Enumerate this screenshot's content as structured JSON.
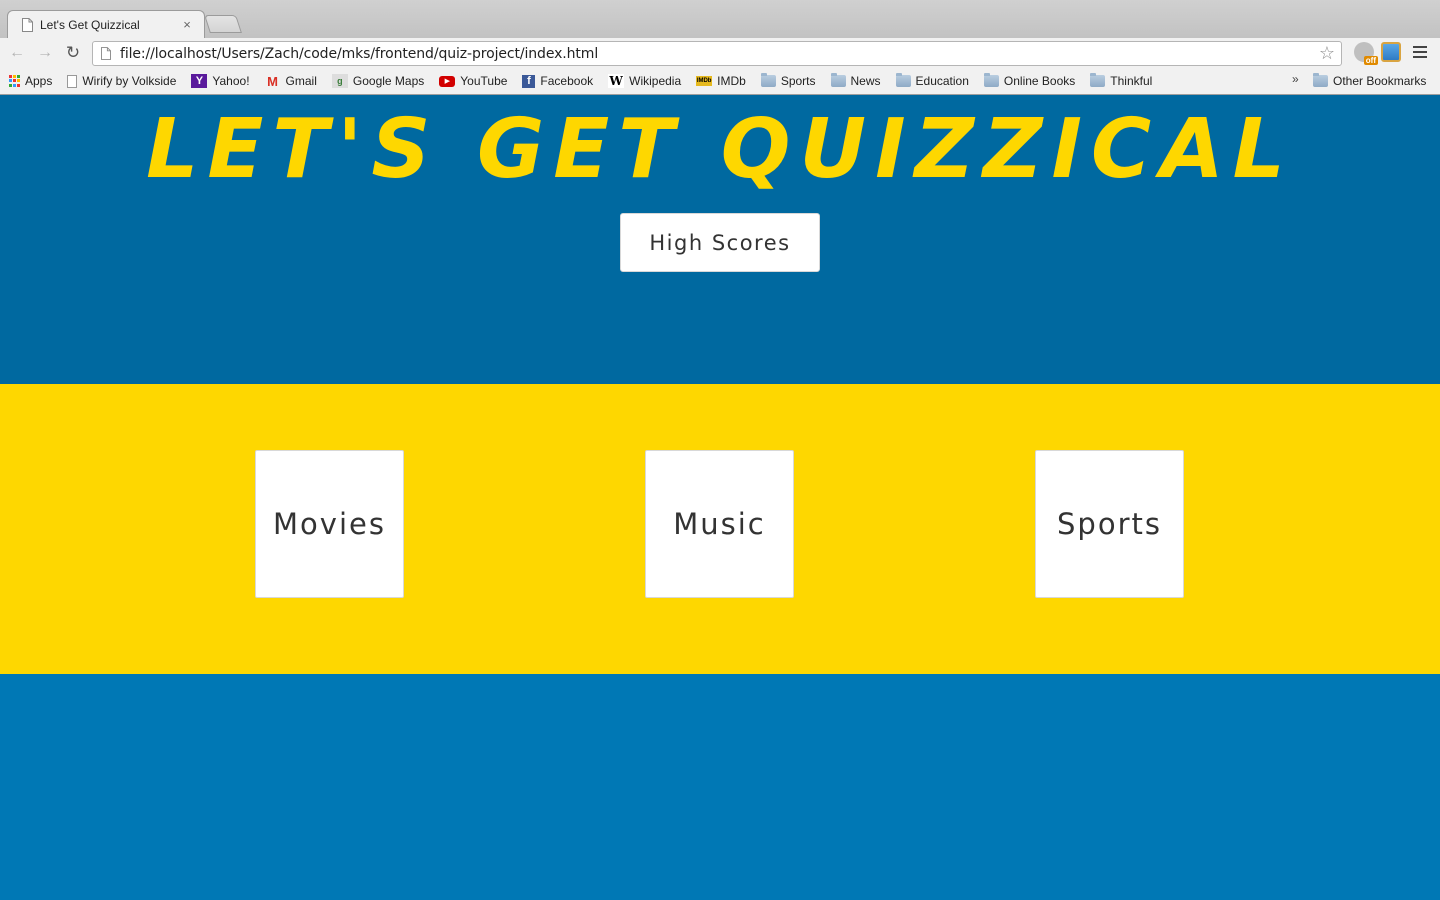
{
  "browser": {
    "tab_title": "Let's Get Quizzical",
    "tab_close": "×",
    "url": "file://localhost/Users/Zach/code/mks/frontend/quiz-project/index.html",
    "nav": {
      "back": "←",
      "forward": "→",
      "reload": "↻",
      "star": "☆"
    },
    "extension_badge": "off",
    "bookmarks": [
      {
        "label": "Apps",
        "icon": "apps-grid-icon"
      },
      {
        "label": "Wirify by Volkside",
        "icon": "page-icon"
      },
      {
        "label": "Yahoo!",
        "icon": "yahoo-icon",
        "glyph": "Y"
      },
      {
        "label": "Gmail",
        "icon": "gmail-icon",
        "glyph": "M"
      },
      {
        "label": "Google Maps",
        "icon": "google-maps-icon",
        "glyph": "g"
      },
      {
        "label": "YouTube",
        "icon": "youtube-icon",
        "glyph": "▶"
      },
      {
        "label": "Facebook",
        "icon": "facebook-icon",
        "glyph": "f"
      },
      {
        "label": "Wikipedia",
        "icon": "wikipedia-icon",
        "glyph": "W"
      },
      {
        "label": "IMDb",
        "icon": "imdb-icon",
        "glyph": "IMDb"
      },
      {
        "label": "Sports",
        "icon": "folder-icon"
      },
      {
        "label": "News",
        "icon": "folder-icon"
      },
      {
        "label": "Education",
        "icon": "folder-icon"
      },
      {
        "label": "Online Books",
        "icon": "folder-icon"
      },
      {
        "label": "Thinkful",
        "icon": "folder-icon"
      }
    ],
    "bookmarks_overflow": "»",
    "other_bookmarks": "Other Bookmarks"
  },
  "page": {
    "title": "LET'S GET QUIZZICAL",
    "high_scores_label": "High Scores",
    "categories": [
      {
        "label": "Movies"
      },
      {
        "label": "Music"
      },
      {
        "label": "Sports"
      }
    ],
    "colors": {
      "header_blue": "#0069a0",
      "accent_yellow": "#fed700",
      "footer_blue": "#0078b5",
      "card_white": "#ffffff",
      "text_dark": "#333333"
    }
  }
}
